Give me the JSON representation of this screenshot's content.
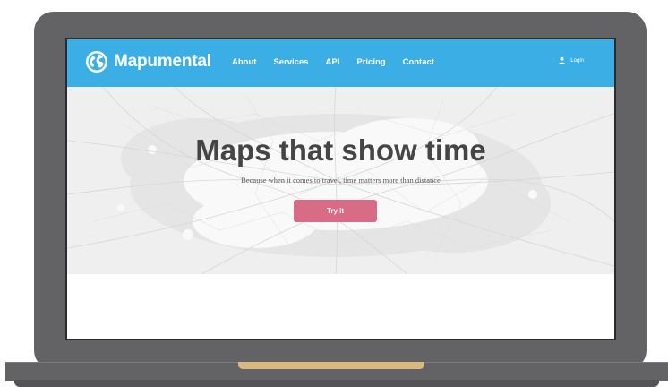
{
  "colors": {
    "nav_background": "#3baee6",
    "button_background": "#d86b86",
    "laptop_body": "#636265",
    "laptop_notch": "#d8b982"
  },
  "brand": {
    "name": "Mapumental",
    "icon": "globe-icon"
  },
  "nav": {
    "items": [
      {
        "label": "About"
      },
      {
        "label": "Services"
      },
      {
        "label": "API"
      },
      {
        "label": "Pricing"
      },
      {
        "label": "Contact"
      }
    ],
    "login_label": "Login",
    "login_icon": "user-icon"
  },
  "hero": {
    "title": "Maps that show time",
    "subtitle": "Because when it comes to travel, time matters more than distance",
    "cta_label": "Try it"
  }
}
